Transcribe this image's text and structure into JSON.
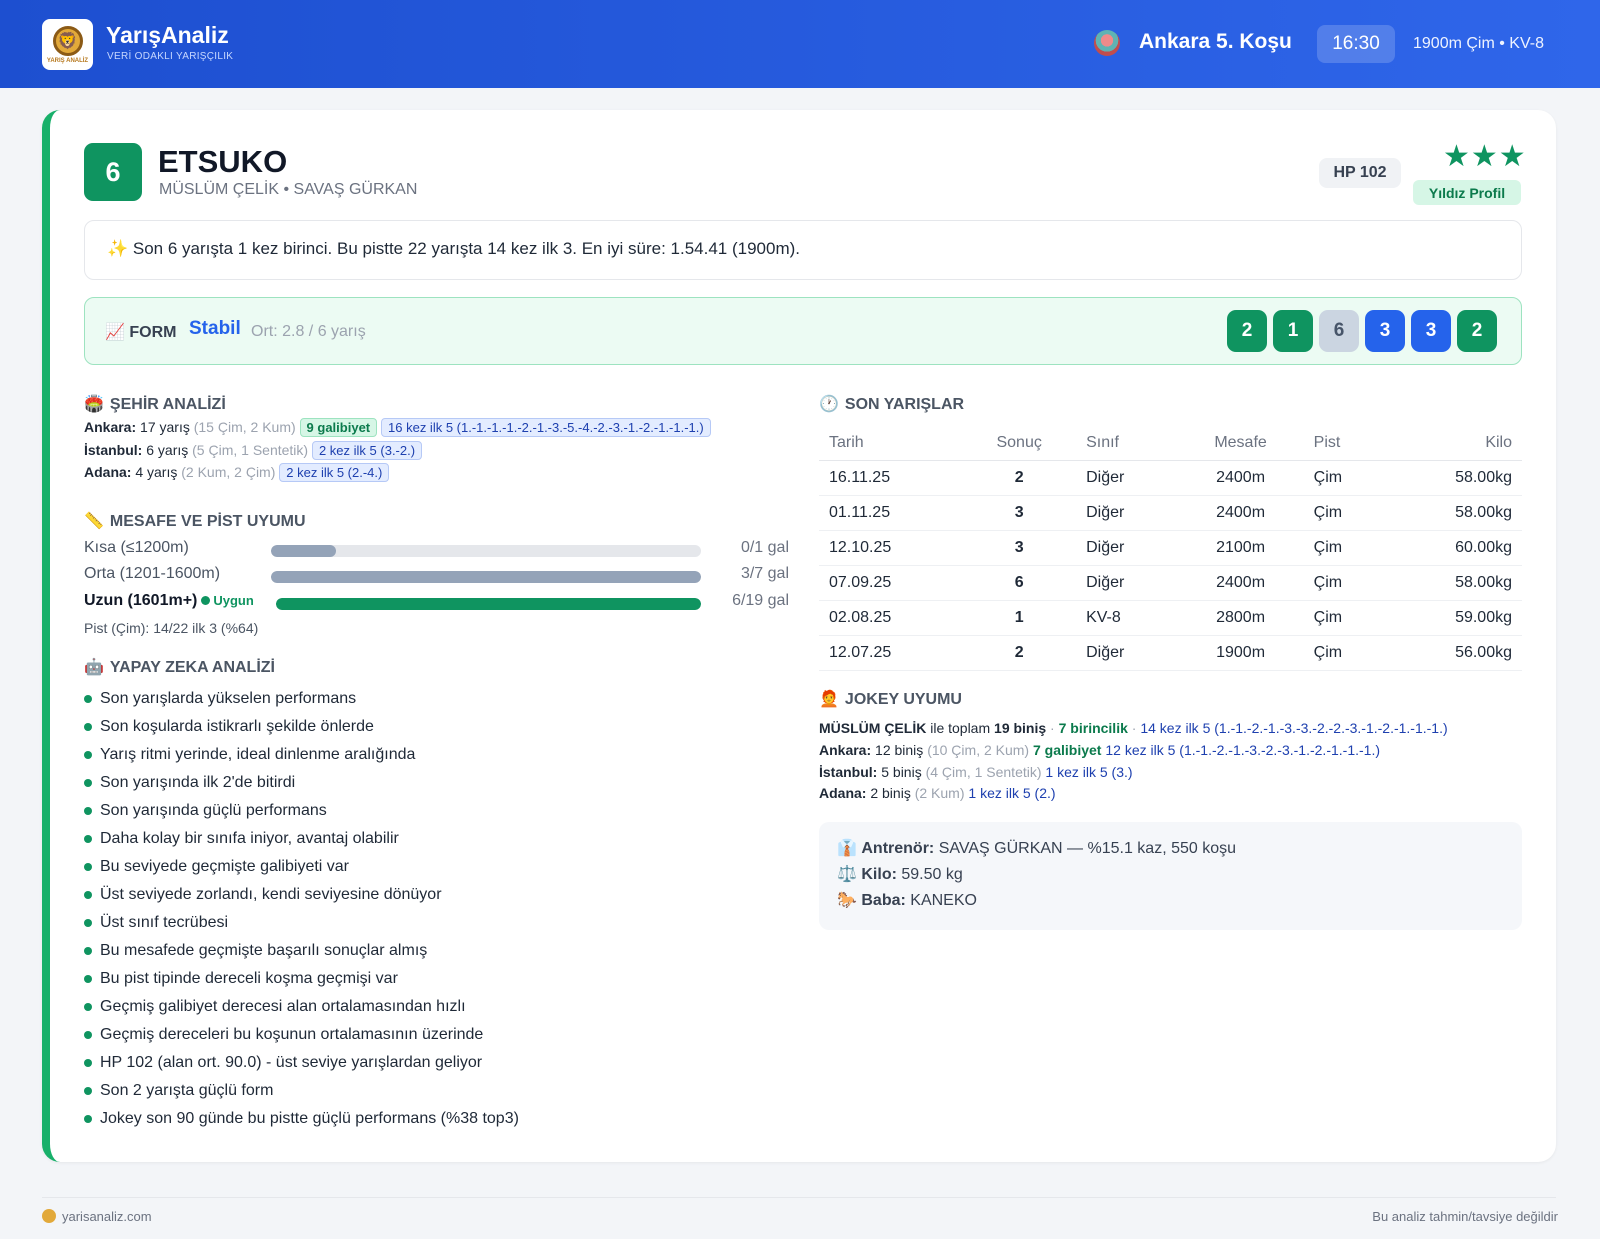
{
  "header": {
    "brand": "YarışAnaliz",
    "tagline": "VERİ ODAKLI YARIŞÇILIK",
    "logo_text": "YARIŞ ANALİZ",
    "race_title": "Ankara 5. Koşu",
    "race_time": "16:30",
    "race_info": "1900m Çim • KV-8"
  },
  "horse": {
    "number": "6",
    "name": "ETSUKO",
    "subtitle": "MÜSLÜM ÇELİK • SAVAŞ GÜRKAN",
    "hp": "HP 102",
    "stars": "★★★",
    "star_label": "Yıldız Profil"
  },
  "summary": "✨ Son 6 yarışta 1 kez birinci. Bu pistte 22 yarışta 14 kez ilk 3. En iyi süre: 1.54.41 (1900m).",
  "form": {
    "icon": "📈",
    "label": "FORM",
    "trend": "Stabil",
    "avg": "Ort: 2.8 / 6 yarış",
    "results": [
      {
        "value": "2",
        "color": "#0f9460"
      },
      {
        "value": "1",
        "color": "#0f9460"
      },
      {
        "value": "6",
        "color": "#cbd5e1"
      },
      {
        "value": "3",
        "color": "#2563eb"
      },
      {
        "value": "3",
        "color": "#2563eb"
      },
      {
        "value": "2",
        "color": "#0f9460"
      }
    ]
  },
  "city": {
    "title": "ŞEHİR ANALİZİ",
    "icon": "🏟️",
    "rows": [
      {
        "city": "Ankara:",
        "races": "17 yarış",
        "detail": "(15 Çim, 2 Kum)",
        "wins": "9 galibiyet",
        "top5": "16 kez ilk 5 (1.-1.-1.-1.-2.-1.-3.-5.-4.-2.-3.-1.-2.-1.-1.-1.)"
      },
      {
        "city": "İstanbul:",
        "races": "6 yarış",
        "detail": "(5 Çim, 1 Sentetik)",
        "wins": "",
        "top5": "2 kez ilk 5 (3.-2.)"
      },
      {
        "city": "Adana:",
        "races": "4 yarış",
        "detail": "(2 Kum, 2 Çim)",
        "wins": "",
        "top5": "2 kez ilk 5 (2.-4.)"
      }
    ]
  },
  "distance": {
    "title": "MESAFE VE PİST UYUMU",
    "icon": "📏",
    "rows": [
      {
        "label": "Kısa (≤1200m)",
        "value": "0/1 gal",
        "fill": 0.15
      },
      {
        "label": "Orta (1201-1600m)",
        "value": "3/7 gal",
        "fill": 1.0
      },
      {
        "label": "Uzun (1601m+)",
        "value": "6/19 gal",
        "fill": 1.0,
        "badge": "Uygun"
      }
    ],
    "pist": "Pist (Çim): 14/22 ilk 3 (%64)"
  },
  "ai": {
    "title": "YAPAY ZEKA ANALİZİ",
    "icon": "🤖",
    "items": [
      "Son yarışlarda yükselen performans",
      "Son koşularda istikrarlı şekilde önlerde",
      "Yarış ritmi yerinde, ideal dinlenme aralığında",
      "Son yarışında ilk 2'de bitirdi",
      "Son yarışında güçlü performans",
      "Daha kolay bir sınıfa iniyor, avantaj olabilir",
      "Bu seviyede geçmişte galibiyeti var",
      "Üst seviyede zorlandı, kendi seviyesine dönüyor",
      "Üst sınıf tecrübesi",
      "Bu mesafede geçmişte başarılı sonuçlar almış",
      "Bu pist tipinde dereceli koşma geçmişi var",
      "Geçmiş galibiyet derecesi alan ortalamasından hızlı",
      "Geçmiş dereceleri bu koşunun ortalamasının üzerinde",
      "HP 102 (alan ort. 90.0) - üst seviye yarışlardan geliyor",
      "Son 2 yarışta güçlü form",
      "Jokey son 90 günde bu pistte güçlü performans (%38 top3)"
    ]
  },
  "races": {
    "title": "SON YARIŞLAR",
    "icon": "🕐",
    "columns": [
      "Tarih",
      "Sonuç",
      "Sınıf",
      "Mesafe",
      "Pist",
      "Kilo"
    ],
    "rows": [
      {
        "date": "16.11.25",
        "result": "2",
        "cls": "Diğer",
        "dist": "2400m",
        "track": "Çim",
        "kg": "58.00kg",
        "rc": "res-o"
      },
      {
        "date": "01.11.25",
        "result": "3",
        "cls": "Diğer",
        "dist": "2400m",
        "track": "Çim",
        "kg": "58.00kg",
        "rc": "res-o"
      },
      {
        "date": "12.10.25",
        "result": "3",
        "cls": "Diğer",
        "dist": "2100m",
        "track": "Çim",
        "kg": "60.00kg",
        "rc": "res-o"
      },
      {
        "date": "07.09.25",
        "result": "6",
        "cls": "Diğer",
        "dist": "2400m",
        "track": "Çim",
        "kg": "58.00kg",
        "rc": "res-s"
      },
      {
        "date": "02.08.25",
        "result": "1",
        "cls": "KV-8",
        "dist": "2800m",
        "track": "Çim",
        "kg": "59.00kg",
        "rc": "res-g"
      },
      {
        "date": "12.07.25",
        "result": "2",
        "cls": "Diğer",
        "dist": "1900m",
        "track": "Çim",
        "kg": "56.00kg",
        "rc": "res-o"
      }
    ]
  },
  "jockey": {
    "title": "JOKEY UYUMU",
    "icon": "🧑‍🦰",
    "summary": {
      "name": "MÜSLÜM ÇELİK",
      "mid": " ile toplam ",
      "rides": "19 biniş",
      "sep": " · ",
      "wins": "7 birincilik",
      "sep2": " · ",
      "top5": "14 kez ilk 5 (1.-1.-2.-1.-3.-3.-2.-2.-3.-1.-2.-1.-1.-1.)"
    },
    "rows": [
      {
        "city": "Ankara:",
        "rides": "12 biniş",
        "detail": "(10 Çim, 2 Kum)",
        "wins": "7 galibiyet",
        "top5": "12 kez ilk 5 (1.-1.-2.-1.-3.-2.-3.-1.-2.-1.-1.-1.)"
      },
      {
        "city": "İstanbul:",
        "rides": "5 biniş",
        "detail": "(4 Çim, 1 Sentetik)",
        "wins": "",
        "top5": "1 kez ilk 5 (3.)"
      },
      {
        "city": "Adana:",
        "rides": "2 biniş",
        "detail": "(2 Kum)",
        "wins": "",
        "top5": "1 kez ilk 5 (2.)"
      }
    ]
  },
  "info": {
    "trainer_label": "Antrenör:",
    "trainer": "SAVAŞ GÜRKAN — %15.1 kaz, 550 koşu",
    "weight_label": "Kilo:",
    "weight": "59.50 kg",
    "sire_label": "Baba:",
    "sire": "KANEKO"
  },
  "footer": {
    "site": "yarisanaliz.com",
    "disclaimer": "Bu analiz tahmin/tavsiye değildir"
  }
}
